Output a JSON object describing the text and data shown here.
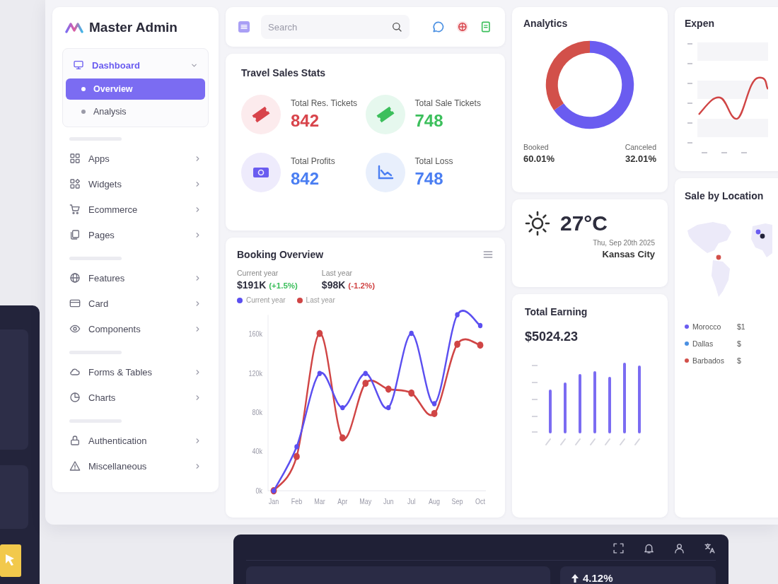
{
  "sidebar": {
    "logo": "Master Admin",
    "sections": [
      {
        "items": [
          {
            "label": "Dashboard",
            "selected": false,
            "expanded": true,
            "children": [
              {
                "label": "Overview",
                "selected": true
              },
              {
                "label": "Analysis",
                "selected": false
              }
            ]
          }
        ]
      },
      {
        "items": [
          {
            "label": "Apps",
            "selected": false,
            "expanded": false
          },
          {
            "label": "Widgets",
            "selected": false,
            "expanded": false
          },
          {
            "label": "Ecommerce",
            "selected": false,
            "expanded": false
          },
          {
            "label": "Pages",
            "selected": false,
            "expanded": false
          }
        ]
      },
      {
        "items": [
          {
            "label": "Features",
            "selected": false,
            "expanded": false
          },
          {
            "label": "Card",
            "selected": false,
            "expanded": false
          },
          {
            "label": "Components",
            "selected": false,
            "expanded": false
          }
        ]
      },
      {
        "items": [
          {
            "label": "Forms & Tables",
            "selected": false,
            "expanded": false
          },
          {
            "label": "Charts",
            "selected": false,
            "expanded": false
          }
        ]
      },
      {
        "items": [
          {
            "label": "Authentication",
            "selected": false,
            "expanded": false
          },
          {
            "label": "Miscellaneous",
            "selected": false,
            "expanded": false
          }
        ]
      }
    ]
  },
  "topbar": {
    "search": {
      "placeholder": "Search"
    }
  },
  "stats": {
    "title": "Travel Sales Stats",
    "items": [
      {
        "label": "Total Res. Tickets",
        "value": "842",
        "color": "#d8444b"
      },
      {
        "label": "Total Sale Tickets",
        "value": "748",
        "color": "#3cbf5c"
      },
      {
        "label": "Total Profits",
        "value": "842",
        "color": "#4a7ef2"
      },
      {
        "label": "Total Loss",
        "value": "748",
        "color": "#4a7ef2"
      }
    ]
  },
  "analytics": {
    "title": "Analytics",
    "chart_data": {
      "type": "donut",
      "values": [
        65.2,
        34.8
      ],
      "colors": [
        "#6a5cf0",
        "#d2504a"
      ]
    },
    "summary": [
      {
        "label": "Booked",
        "value": "60.01%"
      },
      {
        "label": "Canceled",
        "value": "32.01%"
      }
    ]
  },
  "expenses": {
    "title": "Expen"
  },
  "booking": {
    "title": "Booking Overview",
    "summary": [
      {
        "label": "Current year",
        "value": "$191K",
        "change": "(+1.5%)",
        "color": "#3cbf5c"
      },
      {
        "label": "Last year",
        "value": "$98K",
        "change": "(-1.2%)",
        "color": "#d04545"
      }
    ],
    "chart_data": {
      "type": "line",
      "categories": [
        "Jan",
        "Feb",
        "Mar",
        "Apr",
        "May",
        "Jun",
        "Jul",
        "Aug",
        "Sep",
        "Oct"
      ],
      "ylim": [
        0,
        180
      ],
      "yticks": [
        {
          "value": 0,
          "label": "0k"
        },
        {
          "value": 40,
          "label": "40k"
        },
        {
          "value": 80,
          "label": "80k"
        },
        {
          "value": 120,
          "label": "120k"
        },
        {
          "value": 160,
          "label": "160k"
        }
      ],
      "legend": "top",
      "marker": "circle",
      "series": [
        {
          "name": "Current year",
          "color": "#5b4ff0",
          "values": [
            0,
            45,
            120,
            85,
            120,
            85,
            161,
            89,
            180,
            169
          ]
        },
        {
          "name": "Last year",
          "color": "#d04545",
          "values": [
            0,
            35,
            161,
            54,
            110,
            104,
            100,
            79,
            150,
            149
          ]
        }
      ]
    }
  },
  "weather": {
    "temperature": "27°C",
    "date": "Thu, Sep 20th 2025",
    "city": "Kansas City"
  },
  "earning": {
    "title": "Total Earning",
    "amount": "$5024.23"
  },
  "location": {
    "title": "Sale by Location",
    "locations": [
      {
        "name": "Morocco",
        "color": "#6a5cf0",
        "value": "$1"
      },
      {
        "name": "Dallas",
        "color": "#4a90e2",
        "value": "$"
      },
      {
        "name": "Barbados",
        "color": "#d2504a",
        "value": "$"
      }
    ]
  },
  "dark_window": {
    "change": "4.12%"
  }
}
